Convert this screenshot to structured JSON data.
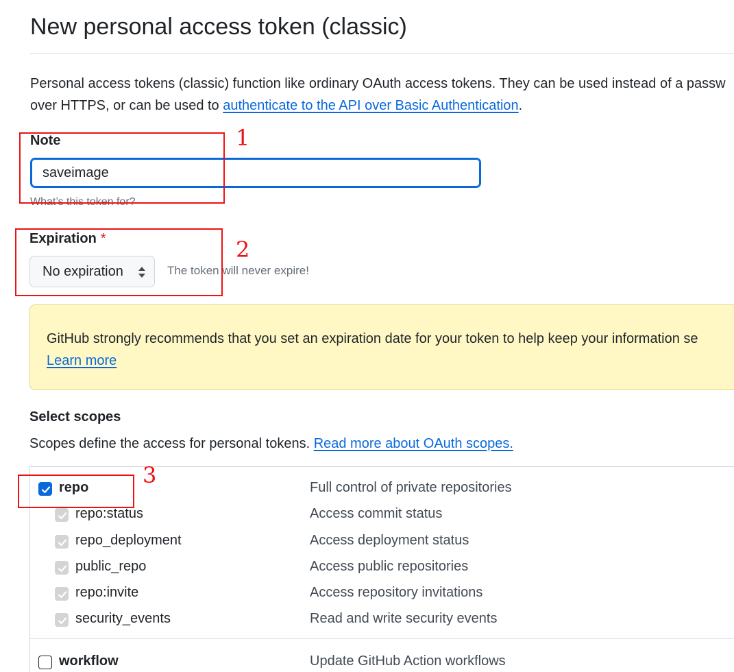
{
  "page": {
    "title": "New personal access token (classic)",
    "intro_text": "Personal access tokens (classic) function like ordinary OAuth access tokens. They can be used instead of a passw",
    "intro_text_2": "over HTTPS, or can be used to ",
    "intro_link": "authenticate to the API over Basic Authentication",
    "intro_end": "."
  },
  "note": {
    "label": "Note",
    "value": "saveimage",
    "hint": "What’s this token for?"
  },
  "expiration": {
    "label": "Expiration",
    "required_mark": "*",
    "selected": "No expiration",
    "note": "The token will never expire!"
  },
  "warning": {
    "text": "GitHub strongly recommends that you set an expiration date for your token to help keep your information se",
    "link": "Learn more"
  },
  "scopes": {
    "title": "Select scopes",
    "description": "Scopes define the access for personal tokens. ",
    "description_link": "Read more about OAuth scopes.",
    "items": [
      {
        "name": "repo",
        "desc": "Full control of private repositories"
      },
      {
        "name": "repo:status",
        "desc": "Access commit status"
      },
      {
        "name": "repo_deployment",
        "desc": "Access deployment status"
      },
      {
        "name": "public_repo",
        "desc": "Access public repositories"
      },
      {
        "name": "repo:invite",
        "desc": "Access repository invitations"
      },
      {
        "name": "security_events",
        "desc": "Read and write security events"
      },
      {
        "name": "workflow",
        "desc": "Update GitHub Action workflows"
      }
    ]
  },
  "annotations": {
    "label_1": "1",
    "label_2": "2",
    "label_3": "3",
    "color": "#ee1111"
  },
  "colors": {
    "link": "#0969da",
    "focus_border": "#0969da",
    "warning_bg": "#fff8c5",
    "required": "#cf222e"
  }
}
